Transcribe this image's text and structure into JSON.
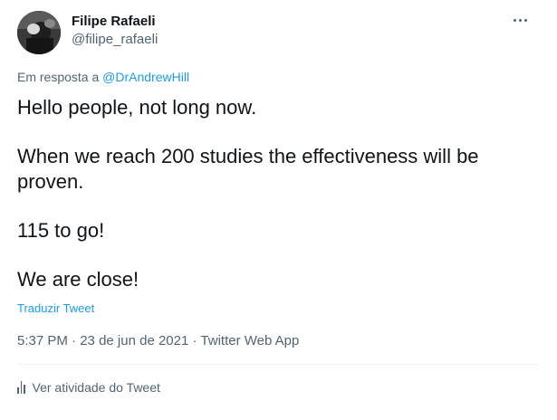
{
  "author": {
    "display_name": "Filipe Rafaeli",
    "handle": "@filipe_rafaeli"
  },
  "more_icon": "more-horizontal-icon",
  "reply": {
    "prefix": "Em resposta a ",
    "mention": "@DrAndrewHill"
  },
  "tweet": {
    "paragraphs": [
      "Hello people, not long now.",
      "When we reach 200 studies the effectiveness will be proven.",
      "115 to go!",
      "We are close!"
    ]
  },
  "translate_label": "Traduzir Tweet",
  "meta": {
    "time": "5:37 PM",
    "sep1": " · ",
    "date": "23 de jun de 2021",
    "sep2": " · ",
    "source": "Twitter Web App"
  },
  "activity": {
    "icon": "analytics-icon",
    "label": "Ver atividade do Tweet"
  },
  "colors": {
    "link": "#1d9bf0",
    "secondary_text": "#536471",
    "primary_text": "#0f1419",
    "divider": "#eff3f4"
  }
}
